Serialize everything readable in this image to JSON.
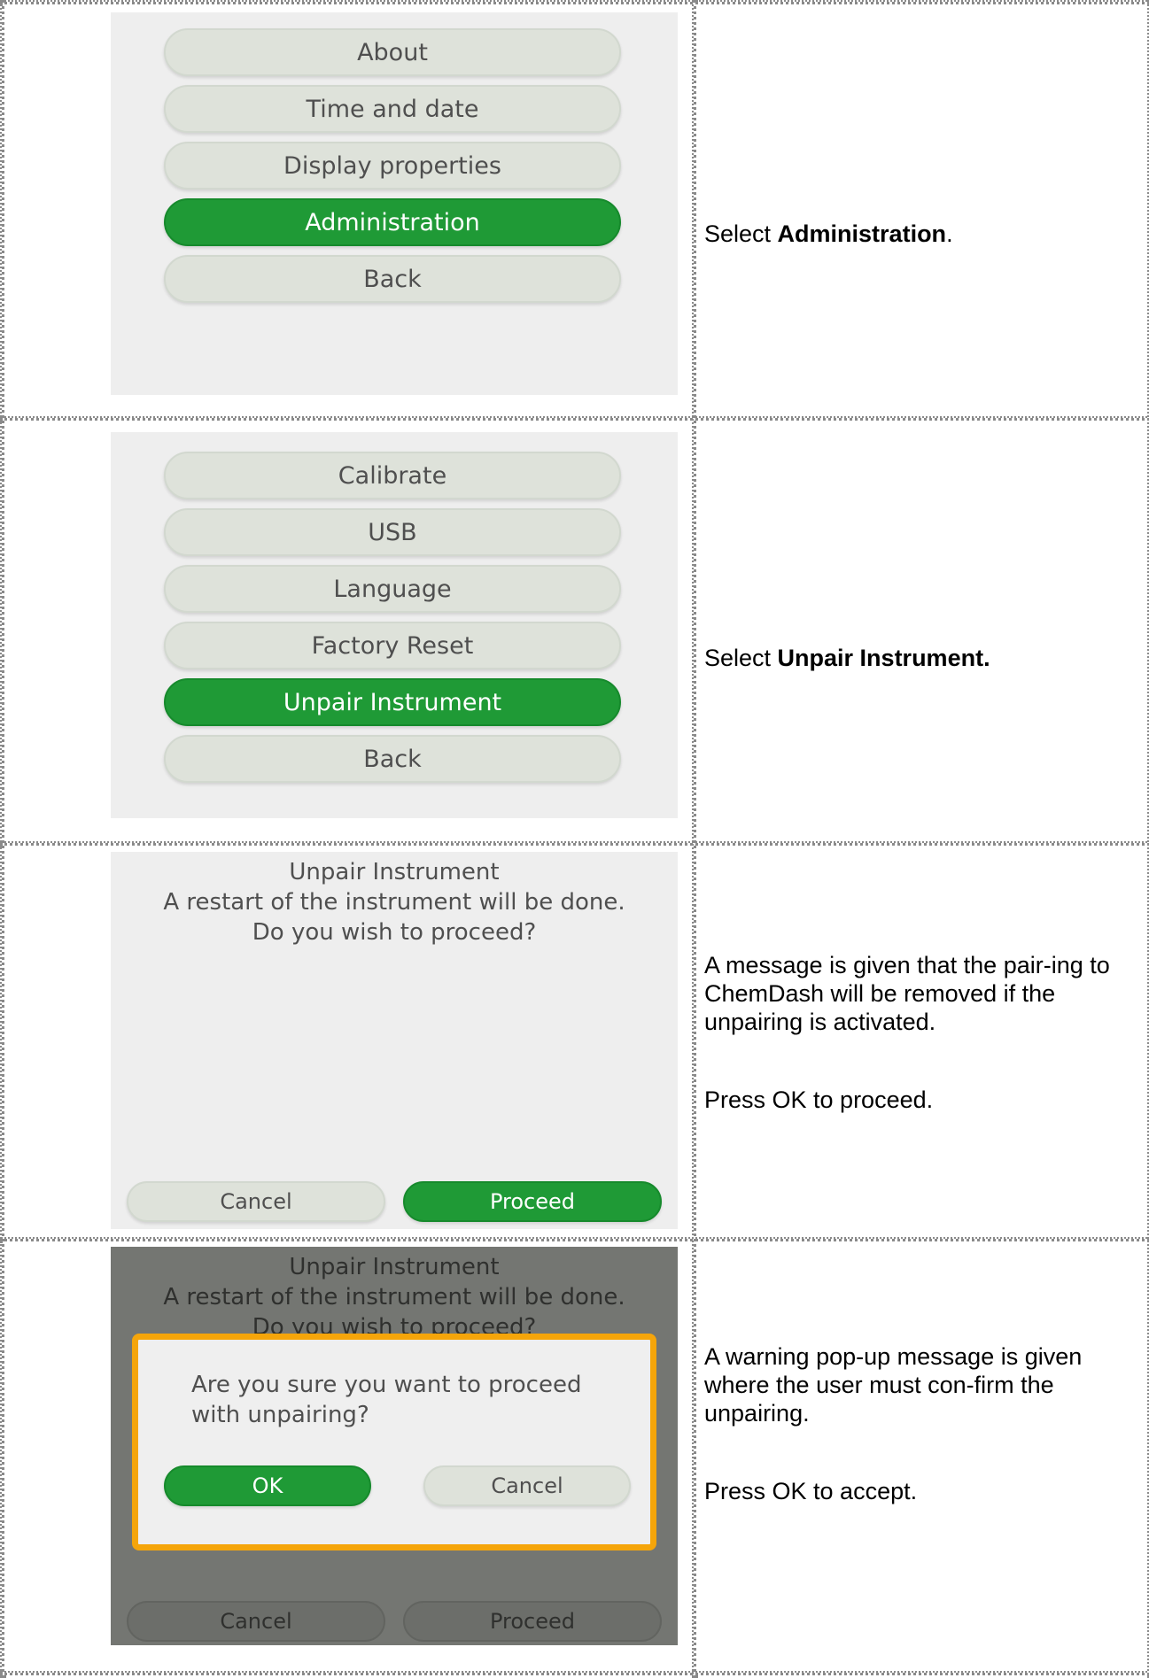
{
  "rows": [
    {
      "menu": [
        "About",
        "Time and date",
        "Display properties",
        "Administration",
        "Back"
      ],
      "instruction": {
        "prefix": "Select ",
        "bold": "Administration",
        "suffix": "."
      }
    },
    {
      "menu": [
        "Calibrate",
        "USB",
        "Language",
        "Factory Reset",
        "Unpair Instrument",
        "Back"
      ],
      "instruction": {
        "prefix": "Select ",
        "bold": "Unpair Instrument.",
        "suffix": ""
      }
    },
    {
      "dialog": {
        "title": "Unpair Instrument",
        "line1": "A restart of the instrument will be done.",
        "line2": "Do you wish to proceed?",
        "cancel": "Cancel",
        "proceed": "Proceed"
      },
      "instruction": {
        "para1": "A message is given that the pair-ing to ChemDash will be removed if the unpairing is activated.",
        "para2": "Press OK to proceed."
      }
    },
    {
      "dialog": {
        "title": "Unpair Instrument",
        "line1": "A restart of the instrument will be done.",
        "line2": "Do you wish to proceed?",
        "cancel": "Cancel",
        "proceed": "Proceed"
      },
      "popup": {
        "message": "Are you sure you want to proceed with unpairing?",
        "ok": "OK",
        "cancel": "Cancel"
      },
      "instruction": {
        "para1": "A warning pop-up message is given where the user must con-firm the unpairing.",
        "para2": "Press OK to accept."
      }
    }
  ],
  "colors": {
    "active_button": "#1f9a36",
    "inactive_button": "#dee2da",
    "popup_border": "#f5a50a",
    "screen_bg": "#eeeeee",
    "dim_overlay": "#747672"
  }
}
